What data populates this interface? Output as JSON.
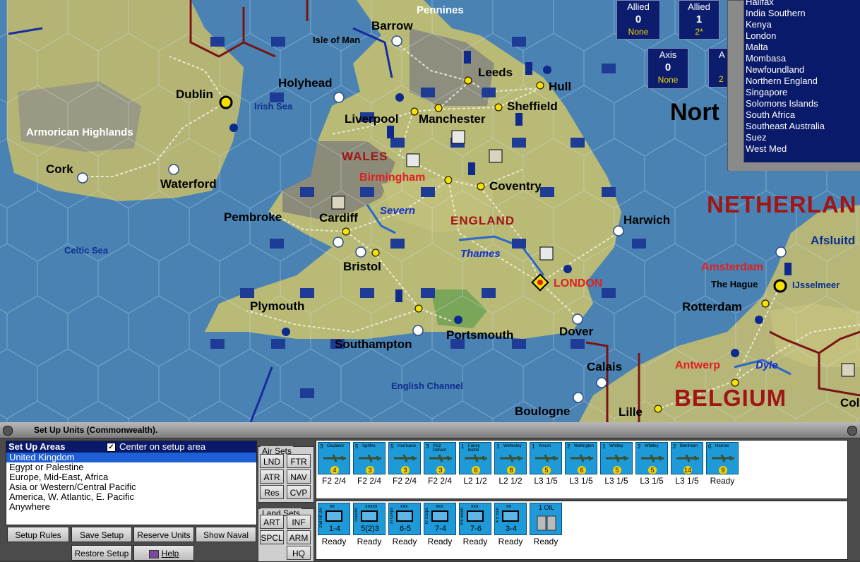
{
  "map": {
    "cities": [
      {
        "name": "Barrow"
      },
      {
        "name": "Isle of Man"
      },
      {
        "name": "Pennines"
      },
      {
        "name": "Leeds"
      },
      {
        "name": "Hull"
      },
      {
        "name": "Holyhead"
      },
      {
        "name": "Dublin"
      },
      {
        "name": "Sheffield"
      },
      {
        "name": "Liverpool"
      },
      {
        "name": "Manchester"
      },
      {
        "name": "Armorican Highlands"
      },
      {
        "name": "Cork"
      },
      {
        "name": "Waterford"
      },
      {
        "name": "Coventry"
      },
      {
        "name": "Pembroke"
      },
      {
        "name": "Cardiff"
      },
      {
        "name": "Harwich"
      },
      {
        "name": "Bristol"
      },
      {
        "name": "Plymouth"
      },
      {
        "name": "Portsmouth"
      },
      {
        "name": "Dover"
      },
      {
        "name": "Southampton"
      },
      {
        "name": "Calais"
      },
      {
        "name": "Boulogne"
      },
      {
        "name": "Lille"
      },
      {
        "name": "Rotterdam"
      },
      {
        "name": "The Hague"
      },
      {
        "name": "IJsselmeer"
      },
      {
        "name": "Afsluitd"
      },
      {
        "name": "Col"
      }
    ],
    "capitals": {
      "london": "LONDON",
      "birmingham": "Birmingham",
      "amsterdam": "Amsterdam",
      "antwerp": "Antwerp"
    },
    "regions": {
      "wales": "WALES",
      "england": "ENGLAND",
      "netherlands": "NETHERLAN",
      "belgium": "BELGIUM",
      "north": "Nort"
    },
    "seas": {
      "irish": "Irish Sea",
      "celtic": "Celtic Sea",
      "channel": "English Channel"
    },
    "rivers": {
      "severn": "Severn",
      "thames": "Thames",
      "dyle": "Dyle"
    }
  },
  "scores": {
    "allied1": {
      "title": "Allied",
      "value": "0",
      "sub": "None"
    },
    "allied2": {
      "title": "Allied",
      "value": "1",
      "sub": "2*"
    },
    "axis": {
      "title": "Axis",
      "value": "0",
      "sub": "None"
    },
    "axis2": {
      "title": "A",
      "sub": "2"
    }
  },
  "area_list": [
    "Halifax",
    "India Southern",
    "Kenya",
    "London",
    "Malta",
    "Mombasa",
    "Newfoundland",
    "Northern England",
    "Singapore",
    "Solomons Islands",
    "South Africa",
    "Southeast Australia",
    "Suez",
    "West Med"
  ],
  "panel": {
    "title": "Set Up Units (Commonwealth).",
    "setup_areas": {
      "header": "Set Up Areas",
      "center_label": "Center on setup area",
      "items": [
        "United Kingdom",
        "Egypt or Palestine",
        "Europe, Mid-East, Africa",
        "Asia or Western/Central Pacific",
        "America, W. Atlantic, E. Pacific",
        "Anywhere"
      ]
    },
    "buttons": {
      "setup_rules": "Setup Rules",
      "save_setup": "Save Setup",
      "reserve_units": "Reserve Units",
      "show_naval": "Show Naval",
      "restore_setup": "Restore Setup",
      "help": "Help"
    },
    "air_sets": {
      "label": "Air Sets",
      "buttons": [
        "LND",
        "FTR",
        "ATR",
        "NAV",
        "Res",
        "CVP"
      ]
    },
    "land_sets": {
      "label": "Land Sets",
      "buttons": [
        "ART",
        "INF",
        "SPCL",
        "ARM",
        "HQ"
      ]
    },
    "air_units": [
      {
        "name": "Gladiator",
        "top": "3",
        "badge": "4",
        "status": "F2 2/4"
      },
      {
        "name": "Spitfire",
        "top": "5",
        "badge": "3",
        "status": "F2 2/4"
      },
      {
        "name": "Hurricane",
        "top": "5",
        "badge": "3",
        "status": "F2 2/4"
      },
      {
        "name": "P.82 Defiant",
        "top": "3",
        "badge": "3",
        "status": "F2 2/4"
      },
      {
        "name": "Fairey Battle",
        "top": "1",
        "badge": "6",
        "status": "L2 1/2"
      },
      {
        "name": "Wellesley",
        "top": "1",
        "badge": "8",
        "status": "L2 1/2"
      },
      {
        "name": "Anson",
        "top": "1",
        "badge": "5",
        "status": "L3 1/5"
      },
      {
        "name": "Wellington",
        "top": "2",
        "badge": "6",
        "status": "L3 1/5"
      },
      {
        "name": "Whitley",
        "top": "1",
        "badge": "5",
        "status": "L3 1/5"
      },
      {
        "name": "Whitley",
        "top": "2",
        "badge": "5",
        "status": "L3 1/5"
      },
      {
        "name": "Blenheim",
        "top": "2",
        "badge": "14",
        "status": "L3 1/5"
      },
      {
        "name": "Harrow",
        "top": "0",
        "badge": "9",
        "status": "Ready"
      }
    ],
    "land_units": [
      {
        "name": "2nd Inf Div",
        "size": "xx",
        "strength": "1-4",
        "status": "Ready"
      },
      {
        "name": "Guards",
        "size": "xxxxx",
        "strength": "5(2)3",
        "status": "Ready"
      },
      {
        "name": "XI Corps",
        "size": "xxx",
        "strength": "6-5",
        "status": "Ready"
      },
      {
        "name": "IV Corps",
        "size": "xxx",
        "strength": "7-4",
        "status": "Ready"
      },
      {
        "name": "VIII Mech",
        "size": "xxx",
        "strength": "7-6",
        "status": "Ready"
      },
      {
        "name": "4.5 Inch",
        "size": "xx",
        "strength": "3-4",
        "status": "Ready"
      },
      {
        "name": "OIL",
        "size": "1 OIL",
        "strength": "",
        "status": "Ready"
      }
    ]
  }
}
